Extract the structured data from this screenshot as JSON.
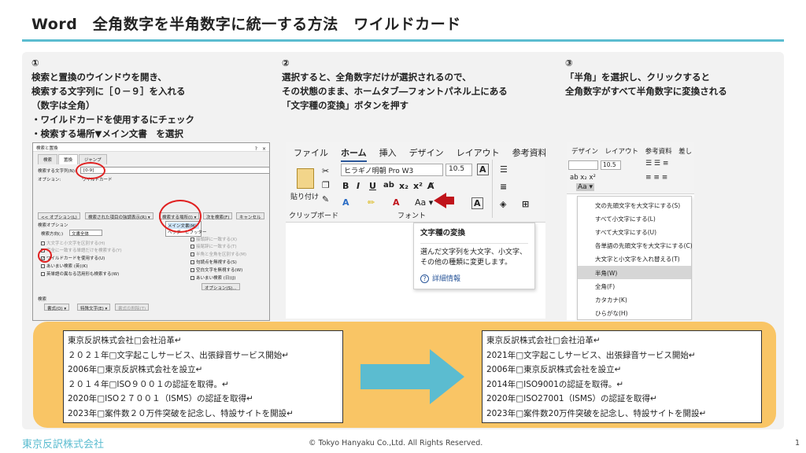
{
  "slide": {
    "title": "Word　全角数字を半角数字に統一する方法　ワイルドカード",
    "footer_logo": "東京反訳株式会社",
    "footer_copyright": "© Tokyo Hanyaku Co.,Ltd. All Rights Reserved.",
    "page_number": "1"
  },
  "steps": [
    {
      "number": "①",
      "lines": [
        "検索と置換のウインドウを開き、",
        "検索する文字列に［０－９］を入れる",
        "（数字は全角）",
        "・ワイルドカードを使用するにチェック",
        "・検索する場所▼メイン文書　を選択"
      ]
    },
    {
      "number": "②",
      "lines": [
        "選択すると、全角数字だけが選択されるので、",
        "その状態のまま、ホームタブ―フォントパネル上にある",
        "「文字種の変換」ボタンを押す"
      ]
    },
    {
      "number": "③",
      "lines": [
        "「半角」を選択し、クリックすると",
        "全角数字がすべて半角数字に変換される"
      ]
    }
  ],
  "dialog": {
    "title": "検索と置換",
    "close": "?　×",
    "tabs": [
      "検索",
      "置換",
      "ジャンプ"
    ],
    "search_label": "検索する文字列(N):",
    "search_value": "[0-9]",
    "options_label": "オプション:",
    "options_value": "ワイルドカード",
    "buttons": {
      "less": "<< オプション(L)",
      "highlight": "検索された項目の強調表示(R) ▾",
      "scope": "検索する場所(I) ▾",
      "find_next": "次を検索(F)",
      "cancel": "キャンセル"
    },
    "scope_menu": [
      "メイン文書(M)",
      "ヘッダーとフッター"
    ],
    "search_options_heading": "検索オプション",
    "direction_label": "検索方向(;)",
    "direction_value": "文書全体",
    "left_options": [
      "大文字と小文字を区別する(H)",
      "完全に一致する単語だけを検索する(Y)",
      "ワイルドカードを使用する(U)",
      "あいまい検索 (英)(K)",
      "英単語の異なる活用形も検索する(W)"
    ],
    "right_options": [
      "接頭辞に一致する(X)",
      "接尾辞に一致する(T)",
      "半角と全角を区別する(M)",
      "句読点を無視する(S)",
      "空白文字を無視する(W)",
      "あいまい検索 (日)(J)"
    ],
    "options_button": "オプション(S)...",
    "bottom_heading": "検索",
    "bottom_buttons": [
      "書式(O) ▾",
      "特殊文字(E) ▾",
      "書式の削除(T)"
    ]
  },
  "ribbon": {
    "tabs": [
      "ファイル",
      "ホーム",
      "挿入",
      "デザイン",
      "レイアウト",
      "参考資料"
    ],
    "paste": "貼り付け",
    "clipboard": "クリップボード",
    "font_name": "ヒラギノ明朝 Pro W3",
    "font_size": "10.5",
    "font_group": "フォント",
    "tooltip_title": "文字種の変換",
    "tooltip_body": "選んだ文字列を大文字、小文字、その他の種類に変更します。",
    "tooltip_link": "詳細情報",
    "change_case_button": "Aa ▾"
  },
  "change_case": {
    "tabs": [
      "デザイン",
      "レイアウト",
      "参考資料",
      "差し"
    ],
    "font_size": "10.5",
    "options": [
      "文の先頭文字を大文字にする(S)",
      "すべて小文字にする(L)",
      "すべて大文字にする(U)",
      "各単語の先頭文字を大文字にする(C)",
      "大文字と小文字を入れ替える(T)",
      "半角(W)",
      "全角(F)",
      "カタカナ(K)",
      "ひらがな(H)"
    ],
    "selected_index": 5
  },
  "before_text": [
    "東京反訳株式会社□会社沿革↵",
    "２０２１年□文字起こしサービス、出張録音サービス開始↵",
    "2006年□東京反訳株式会社を設立↵",
    "２０１４年□ISO９００１の認証を取得。↵",
    "2020年□ISO２７００１（ISMS）の認証を取得↵",
    "2023年□案件数２０万件突破を記念し、特設サイトを開設↵"
  ],
  "after_text": [
    "東京反訳株式会社□会社沿革↵",
    "2021年□文字起こしサービス、出張録音サービス開始↵",
    "2006年□東京反訳株式会社を設立↵",
    "2014年□ISO9001の認証を取得。↵",
    "2020年□ISO27001（ISMS）の認証を取得↵",
    "2023年□案件数20万件突破を記念し、特設サイトを開設↵"
  ],
  "colors": {
    "accent": "#5bbcd0",
    "highlight_band": "#f9c565",
    "callout_red": "#e02020",
    "arrow_red": "#c0141b"
  }
}
